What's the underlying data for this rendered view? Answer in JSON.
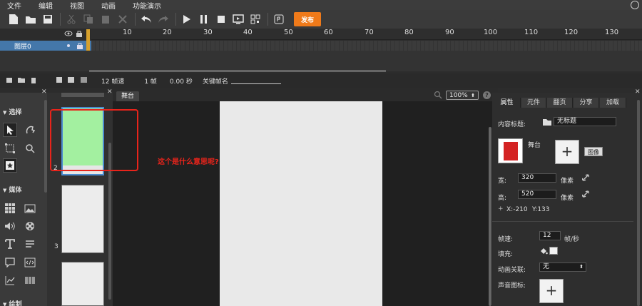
{
  "menu": {
    "items": [
      "文件",
      "编辑",
      "视图",
      "动画",
      "功能演示"
    ]
  },
  "toolbar": {
    "icons": [
      "new-file-icon",
      "open-folder-icon",
      "save-icon",
      "cut-icon",
      "copy-icon",
      "paste-icon",
      "delete-icon",
      "undo-icon",
      "redo-icon",
      "play-icon",
      "pause-icon",
      "stop-icon",
      "preview-icon",
      "qrcode-icon",
      "export-icon"
    ],
    "publish_label": "发布",
    "accent": "#ef7a1a"
  },
  "timeline": {
    "ruler": [
      "10",
      "20",
      "30",
      "40",
      "50",
      "60",
      "70",
      "80",
      "90",
      "100",
      "110",
      "120",
      "130"
    ],
    "layer_name": "图层0",
    "fps_text": "12 帧速",
    "frame_text": "1 帧",
    "time_text": "0.00 秒",
    "keyframe_label": "关键帧名"
  },
  "tools": {
    "select_title": "选择",
    "media_title": "媒体",
    "draw_title": "绘制"
  },
  "scenes": {
    "numbers": [
      "2",
      "3"
    ]
  },
  "stage": {
    "tab_label": "舞台",
    "zoom": "100%"
  },
  "annotation": {
    "text": "这个是什么意思呢?",
    "color": "#e8241b"
  },
  "props": {
    "tabs": [
      "属性",
      "元件",
      "翻页",
      "分享",
      "加载"
    ],
    "content_title_label": "内容标题:",
    "content_title_value": "无标题",
    "stage_label": "舞台",
    "image_btn": "图像",
    "width_label": "宽:",
    "width_value": "320",
    "height_label": "高:",
    "height_value": "520",
    "unit": "像素",
    "x_coord": "X:-210",
    "y_coord": "Y:133",
    "fps_label": "帧速:",
    "fps_value": "12",
    "fps_unit": "帧/秒",
    "fill_label": "填充:",
    "anim_link_label": "动画关联:",
    "anim_link_value": "无",
    "sound_icon_label": "声音图标:"
  }
}
